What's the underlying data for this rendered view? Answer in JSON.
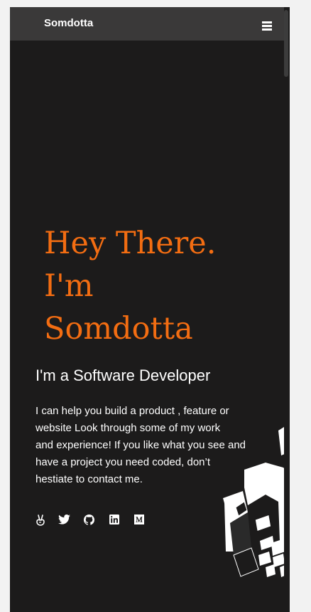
{
  "nav": {
    "brand": "Somdotta",
    "menu_icon": "hamburger-menu-icon"
  },
  "hero": {
    "title_lines": [
      "Hey There.",
      "I'm",
      "Somdotta"
    ],
    "subtitle": "I'm a Software Developer",
    "intro_lines": [
      "I can help you build a product , feature or",
      "website Look through some of my work",
      "and experience! If you like what you see and",
      "have a project you need coded, don’t",
      "hestiate to contact me."
    ]
  },
  "socials": [
    {
      "icon": "angellist-icon"
    },
    {
      "icon": "twitter-icon"
    },
    {
      "icon": "github-icon"
    },
    {
      "icon": "linkedin-icon"
    },
    {
      "icon": "medium-icon"
    }
  ],
  "colors": {
    "background": "#1c1b1b",
    "navbar": "#3a3939",
    "accent": "#f36d12",
    "text": "#ffffff"
  }
}
